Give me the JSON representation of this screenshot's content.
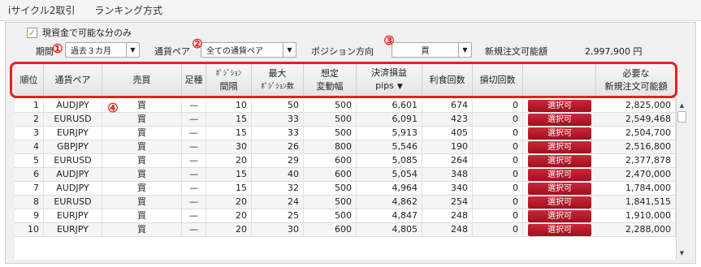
{
  "tabs": [
    "iサイクル2取引",
    "ランキング方式"
  ],
  "filters": {
    "checkbox_label": "現資金で可能な分のみ",
    "checkbox_checked": true,
    "period_label": "期間",
    "period_value": "過去３カ月",
    "currency_label": "通貨ペア",
    "currency_value": "全ての通貨ペア",
    "direction_label": "ポジション方向",
    "direction_value": "買",
    "order_amount_label": "新規注文可能額",
    "order_amount_value": "2,997,900 円"
  },
  "annotations": [
    "①",
    "②",
    "③",
    "④"
  ],
  "colors": {
    "highlight": "#e0241c",
    "select_button": "#b81a2c"
  },
  "table": {
    "headers": {
      "rank": "順位",
      "pair": "通貨ペア",
      "side": "売買",
      "type": "足種",
      "pos_interval_1": "ﾎﾟｼﾞｼｮﾝ",
      "pos_interval_2": "間隔",
      "max_pos_1": "最大",
      "max_pos_2": "ﾎﾟｼﾞｼｮﾝ数",
      "range_1": "想定",
      "range_2": "変動幅",
      "pips_1": "決済損益",
      "pips_2": "pips",
      "profit_count": "利食回数",
      "stop_count": "損切回数",
      "required_1": "必要な",
      "required_2": "新規注文可能額"
    },
    "sort_indicator": "▼",
    "select_label": "選択可",
    "rows": [
      {
        "rank": "1",
        "pair": "AUDJPY",
        "side": "買",
        "type": "—",
        "interval": "10",
        "max": "50",
        "range": "500",
        "pips": "6,601",
        "profit": "674",
        "stop": "0",
        "required": "2,825,000"
      },
      {
        "rank": "2",
        "pair": "EURUSD",
        "side": "買",
        "type": "—",
        "interval": "15",
        "max": "33",
        "range": "500",
        "pips": "6,091",
        "profit": "423",
        "stop": "0",
        "required": "2,549,468"
      },
      {
        "rank": "3",
        "pair": "EURJPY",
        "side": "買",
        "type": "—",
        "interval": "15",
        "max": "33",
        "range": "500",
        "pips": "5,913",
        "profit": "405",
        "stop": "0",
        "required": "2,504,700"
      },
      {
        "rank": "4",
        "pair": "GBPJPY",
        "side": "買",
        "type": "—",
        "interval": "30",
        "max": "26",
        "range": "800",
        "pips": "5,546",
        "profit": "190",
        "stop": "0",
        "required": "2,516,800"
      },
      {
        "rank": "5",
        "pair": "EURUSD",
        "side": "買",
        "type": "—",
        "interval": "20",
        "max": "29",
        "range": "600",
        "pips": "5,085",
        "profit": "264",
        "stop": "0",
        "required": "2,377,878"
      },
      {
        "rank": "6",
        "pair": "AUDJPY",
        "side": "買",
        "type": "—",
        "interval": "15",
        "max": "40",
        "range": "600",
        "pips": "5,054",
        "profit": "348",
        "stop": "0",
        "required": "2,470,000"
      },
      {
        "rank": "7",
        "pair": "AUDJPY",
        "side": "買",
        "type": "—",
        "interval": "15",
        "max": "32",
        "range": "500",
        "pips": "4,964",
        "profit": "340",
        "stop": "0",
        "required": "1,784,000"
      },
      {
        "rank": "8",
        "pair": "EURUSD",
        "side": "買",
        "type": "—",
        "interval": "20",
        "max": "24",
        "range": "500",
        "pips": "4,862",
        "profit": "254",
        "stop": "0",
        "required": "1,841,515"
      },
      {
        "rank": "9",
        "pair": "EURJPY",
        "side": "買",
        "type": "—",
        "interval": "20",
        "max": "25",
        "range": "500",
        "pips": "4,847",
        "profit": "248",
        "stop": "0",
        "required": "1,910,000"
      },
      {
        "rank": "10",
        "pair": "EURJPY",
        "side": "買",
        "type": "—",
        "interval": "20",
        "max": "30",
        "range": "600",
        "pips": "4,805",
        "profit": "248",
        "stop": "0",
        "required": "2,288,000"
      }
    ]
  }
}
